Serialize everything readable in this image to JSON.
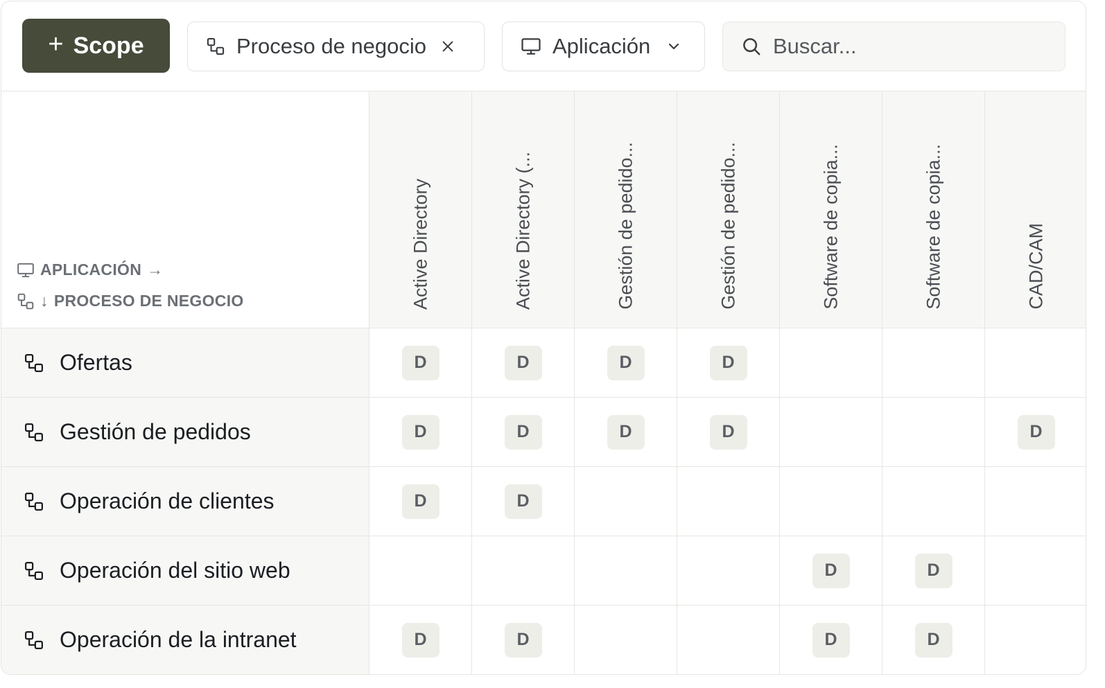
{
  "toolbar": {
    "scope_button": {
      "icon": "plus-icon",
      "label": "Scope"
    },
    "filter_proceso": {
      "icon": "process-icon",
      "label": "Proceso de negocio",
      "close_icon": "close-icon"
    },
    "filter_app": {
      "icon": "monitor-icon",
      "label": "Aplicación",
      "chevron_icon": "chevron-down-icon"
    },
    "search": {
      "icon": "search-icon",
      "placeholder": "Buscar..."
    }
  },
  "matrix": {
    "axis_app_label": "APLICACIÓN",
    "axis_app_arrow": "→",
    "axis_proc_arrow": "↓",
    "axis_proc_label": "PROCESO DE NEGOCIO",
    "columns": [
      "Active Directory",
      "Active Directory (...",
      "Gestión de pedido...",
      "Gestión de pedido...",
      "Software de copia...",
      "Software de copia...",
      "CAD/CAM"
    ],
    "rows": [
      {
        "label": "Ofertas",
        "cells": [
          "D",
          "D",
          "D",
          "D",
          "",
          "",
          ""
        ]
      },
      {
        "label": "Gestión de pedidos",
        "cells": [
          "D",
          "D",
          "D",
          "D",
          "",
          "",
          "D"
        ]
      },
      {
        "label": "Operación de clientes",
        "cells": [
          "D",
          "D",
          "",
          "",
          "",
          "",
          ""
        ]
      },
      {
        "label": "Operación del sitio web",
        "cells": [
          "",
          "",
          "",
          "",
          "D",
          "D",
          ""
        ]
      },
      {
        "label": "Operación de la intranet",
        "cells": [
          "D",
          "D",
          "",
          "",
          "D",
          "D",
          ""
        ]
      }
    ]
  },
  "colors": {
    "scope_button_bg": "#464b3a",
    "header_bg": "#f7f7f5",
    "badge_bg": "#eeeee9"
  }
}
